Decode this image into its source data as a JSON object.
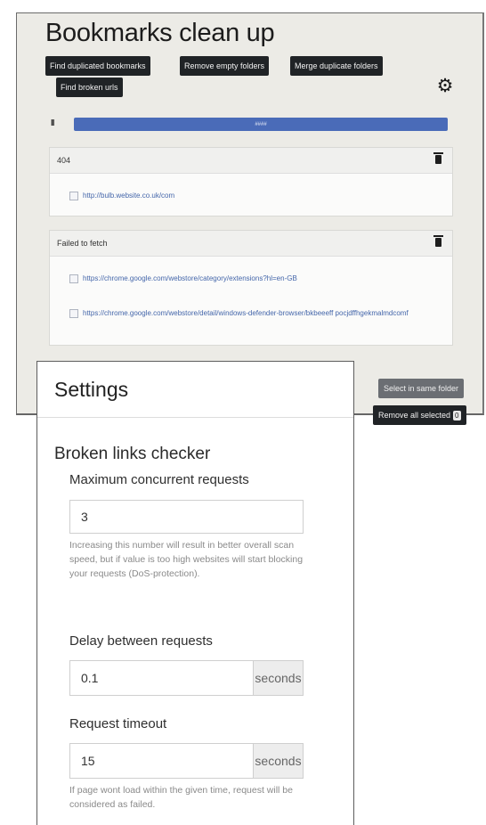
{
  "app": {
    "title": "Bookmarks clean up",
    "toolbar": {
      "find_duplicates": "Find duplicated bookmarks",
      "remove_empty": "Remove empty folders",
      "merge_duplicates": "Merge duplicate folders",
      "find_broken": "Find broken urls"
    },
    "settings_icon": "gear-icon",
    "progress": {
      "fraction": 1.0,
      "label": "####",
      "color": "#4a6bb8"
    },
    "groups": [
      {
        "title": "404",
        "links": [
          "http://bulb.website.co.uk/com"
        ]
      },
      {
        "title": "Failed to fetch",
        "links": [
          "https://chrome.google.com/webstore/category/extensions?hl=en-GB",
          "https://chrome.google.com/webstore/detail/windows-defender-browser/bkbeeeff pocjdffhgekmalmdcomf"
        ]
      }
    ],
    "actions": {
      "select_same_folder": "Select in same folder",
      "remove_all_selected": "Remove all selected",
      "selected_count": "0"
    }
  },
  "settings": {
    "title": "Settings",
    "section": "Broken links checker",
    "max_concurrent": {
      "label": "Maximum concurrent requests",
      "value": "3",
      "help": "Increasing this number will result in better overall scan speed, but if value is too high websites will start blocking your requests (DoS-protection)."
    },
    "delay": {
      "label": "Delay between requests",
      "value": "0.1",
      "unit": "seconds"
    },
    "timeout": {
      "label": "Request timeout",
      "value": "15",
      "unit": "seconds",
      "help": "If page wont load within the given time, request will be considered as failed."
    }
  }
}
